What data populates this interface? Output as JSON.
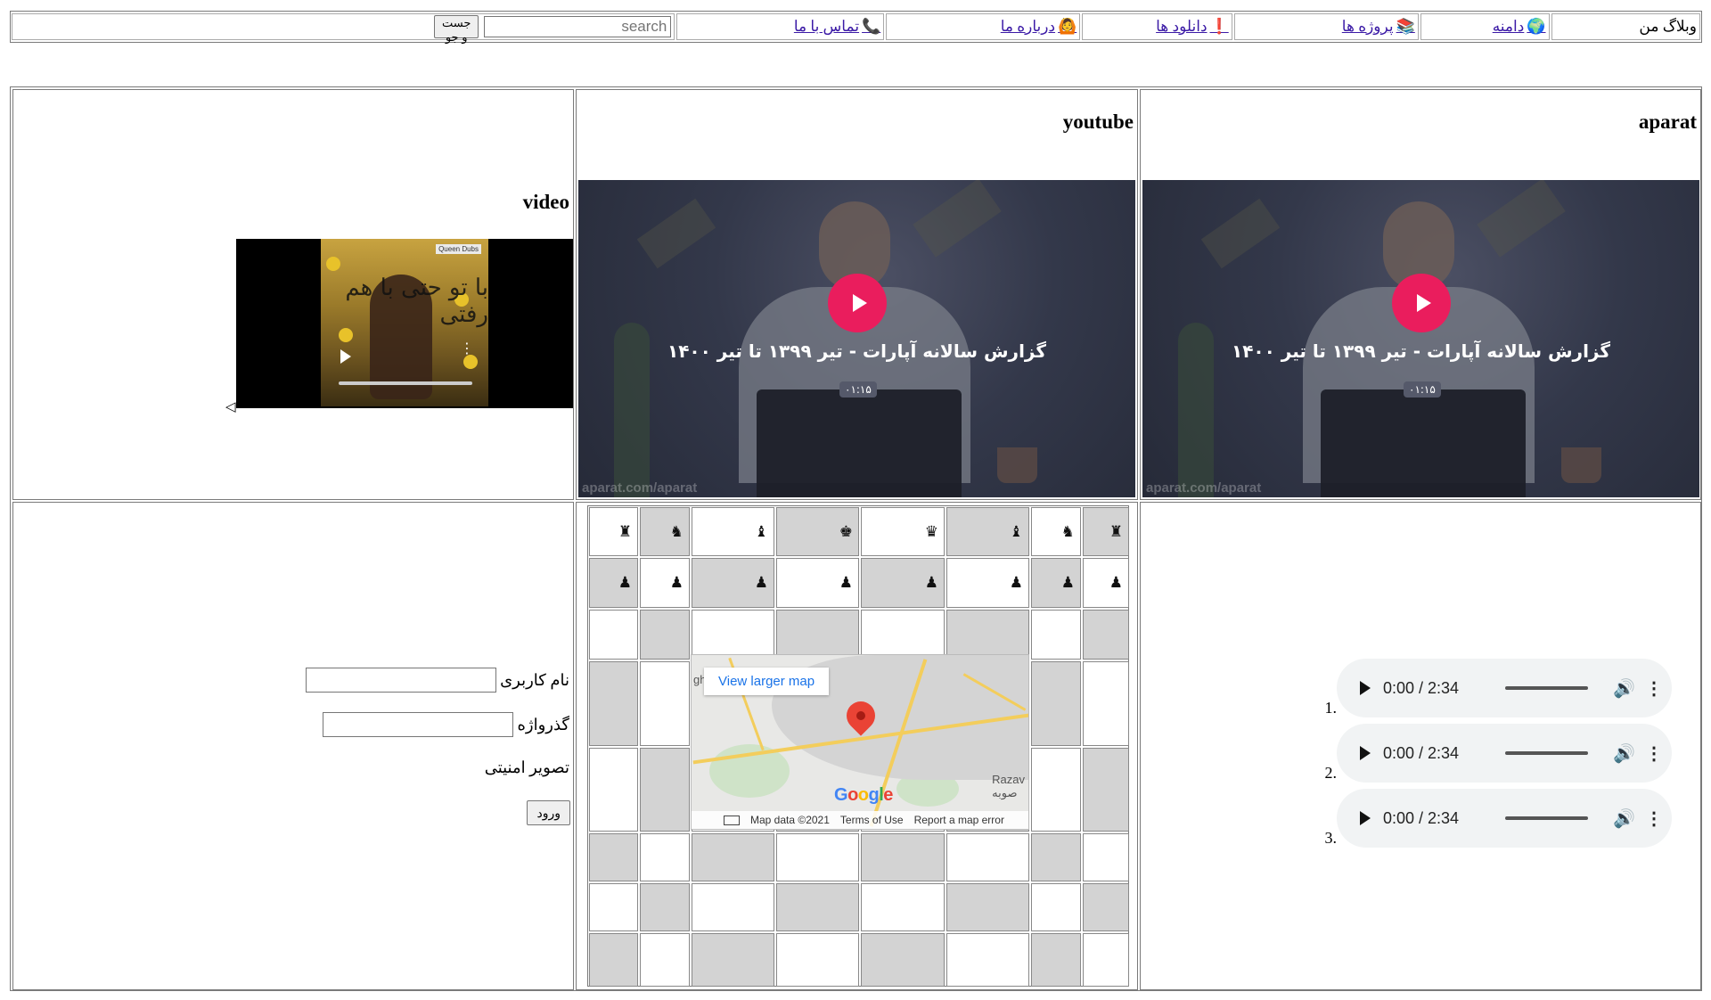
{
  "nav": {
    "title": "وبلاگ من",
    "items": [
      {
        "label": "دامنه",
        "icon": "globe-icon",
        "glyph": "🌍"
      },
      {
        "label": "پروژه ها",
        "icon": "books-icon",
        "glyph": "📚"
      },
      {
        "label": "دانلود ها",
        "icon": "exclamation-icon",
        "glyph": "❗"
      },
      {
        "label": "درباره ما",
        "icon": "person-icon",
        "glyph": "🙆"
      },
      {
        "label": "تماس با ما",
        "icon": "phone-icon",
        "glyph": "📞"
      }
    ],
    "search_placeholder": "search",
    "search_button": "جست و جو"
  },
  "sections": {
    "aparat_heading": "aparat",
    "youtube_heading": "youtube",
    "video_heading": "video"
  },
  "embed": {
    "title": "گزارش سالانه آپارات - تیر ۱۳۹۹ تا تیر ۱۴۰۰",
    "duration": "۰۱:۱۵",
    "watermark": "aparat.com/aparat",
    "accent": "#ea1d5d"
  },
  "video": {
    "caption_label": "Queen Dubs",
    "overlay_text": "با تو حتی با هم رفتی",
    "arrow": "◁"
  },
  "audio": {
    "items": [
      {
        "num": "1.",
        "time": "0:00 / 2:34"
      },
      {
        "num": "2.",
        "time": "0:00 / 2:34"
      },
      {
        "num": "3.",
        "time": "0:00 / 2:34"
      }
    ]
  },
  "chess": {
    "back_row": [
      "♜",
      "♞",
      "♝",
      "♚",
      "♛",
      "♝",
      "♞",
      "♜"
    ],
    "pawn": "♟",
    "dark_color": "#d3d3d3",
    "light_color": "#ffffff"
  },
  "map": {
    "larger_link": "View larger map",
    "map_data": "Map data ©2021",
    "terms": "Terms of Use",
    "report": "Report a map error",
    "brand": [
      "G",
      "o",
      "o",
      "g",
      "l",
      "e"
    ],
    "place_label": "Razav",
    "place_label2": "صوبه",
    "edge_label": "gh"
  },
  "login": {
    "username_label": "نام کاربری",
    "password_label": "گذرواژه",
    "captcha_label": "تصویر امنیتی",
    "submit_label": "ورود"
  }
}
